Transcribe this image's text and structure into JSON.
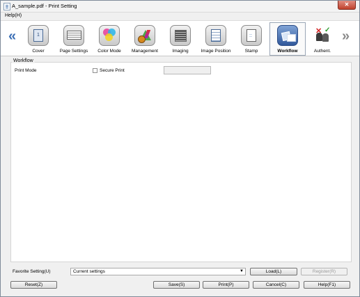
{
  "window": {
    "title": "A_sample.pdf - Print Setting",
    "close_symbol": "✕"
  },
  "menu": {
    "help": "Help(H)"
  },
  "toolbar": {
    "prev_symbol": "«",
    "next_symbol": "»",
    "items": [
      {
        "label": "Cover",
        "icon": "cover-icon"
      },
      {
        "label": "Page Settings",
        "icon": "page-settings-icon"
      },
      {
        "label": "Color Mode",
        "icon": "color-mode-icon"
      },
      {
        "label": "Management",
        "icon": "management-icon"
      },
      {
        "label": "Imaging",
        "icon": "imaging-icon"
      },
      {
        "label": "Image Position",
        "icon": "image-position-icon"
      },
      {
        "label": "Stamp",
        "icon": "stamp-icon"
      },
      {
        "label": "Workflow",
        "icon": "workflow-icon",
        "selected": true
      },
      {
        "label": "Authent.",
        "icon": "authentication-icon"
      }
    ]
  },
  "workflow": {
    "group_title": "Workflow",
    "print_mode_label": "Print Mode",
    "secure_print_label": "Secure Print",
    "secure_print_checked": false
  },
  "favorite": {
    "label": "Favorite Setting(U)",
    "selected": "Current settings",
    "load_label": "Load(L)",
    "register_label": "Register(R)"
  },
  "buttons": {
    "reset": "Reset(Z)",
    "save": "Save(S)",
    "print": "Print(P)",
    "cancel": "Cancel(C)",
    "help": "Help(F1)"
  },
  "colors": {
    "accent": "#3b6fb5",
    "selected_border": "#9aa6b6"
  }
}
